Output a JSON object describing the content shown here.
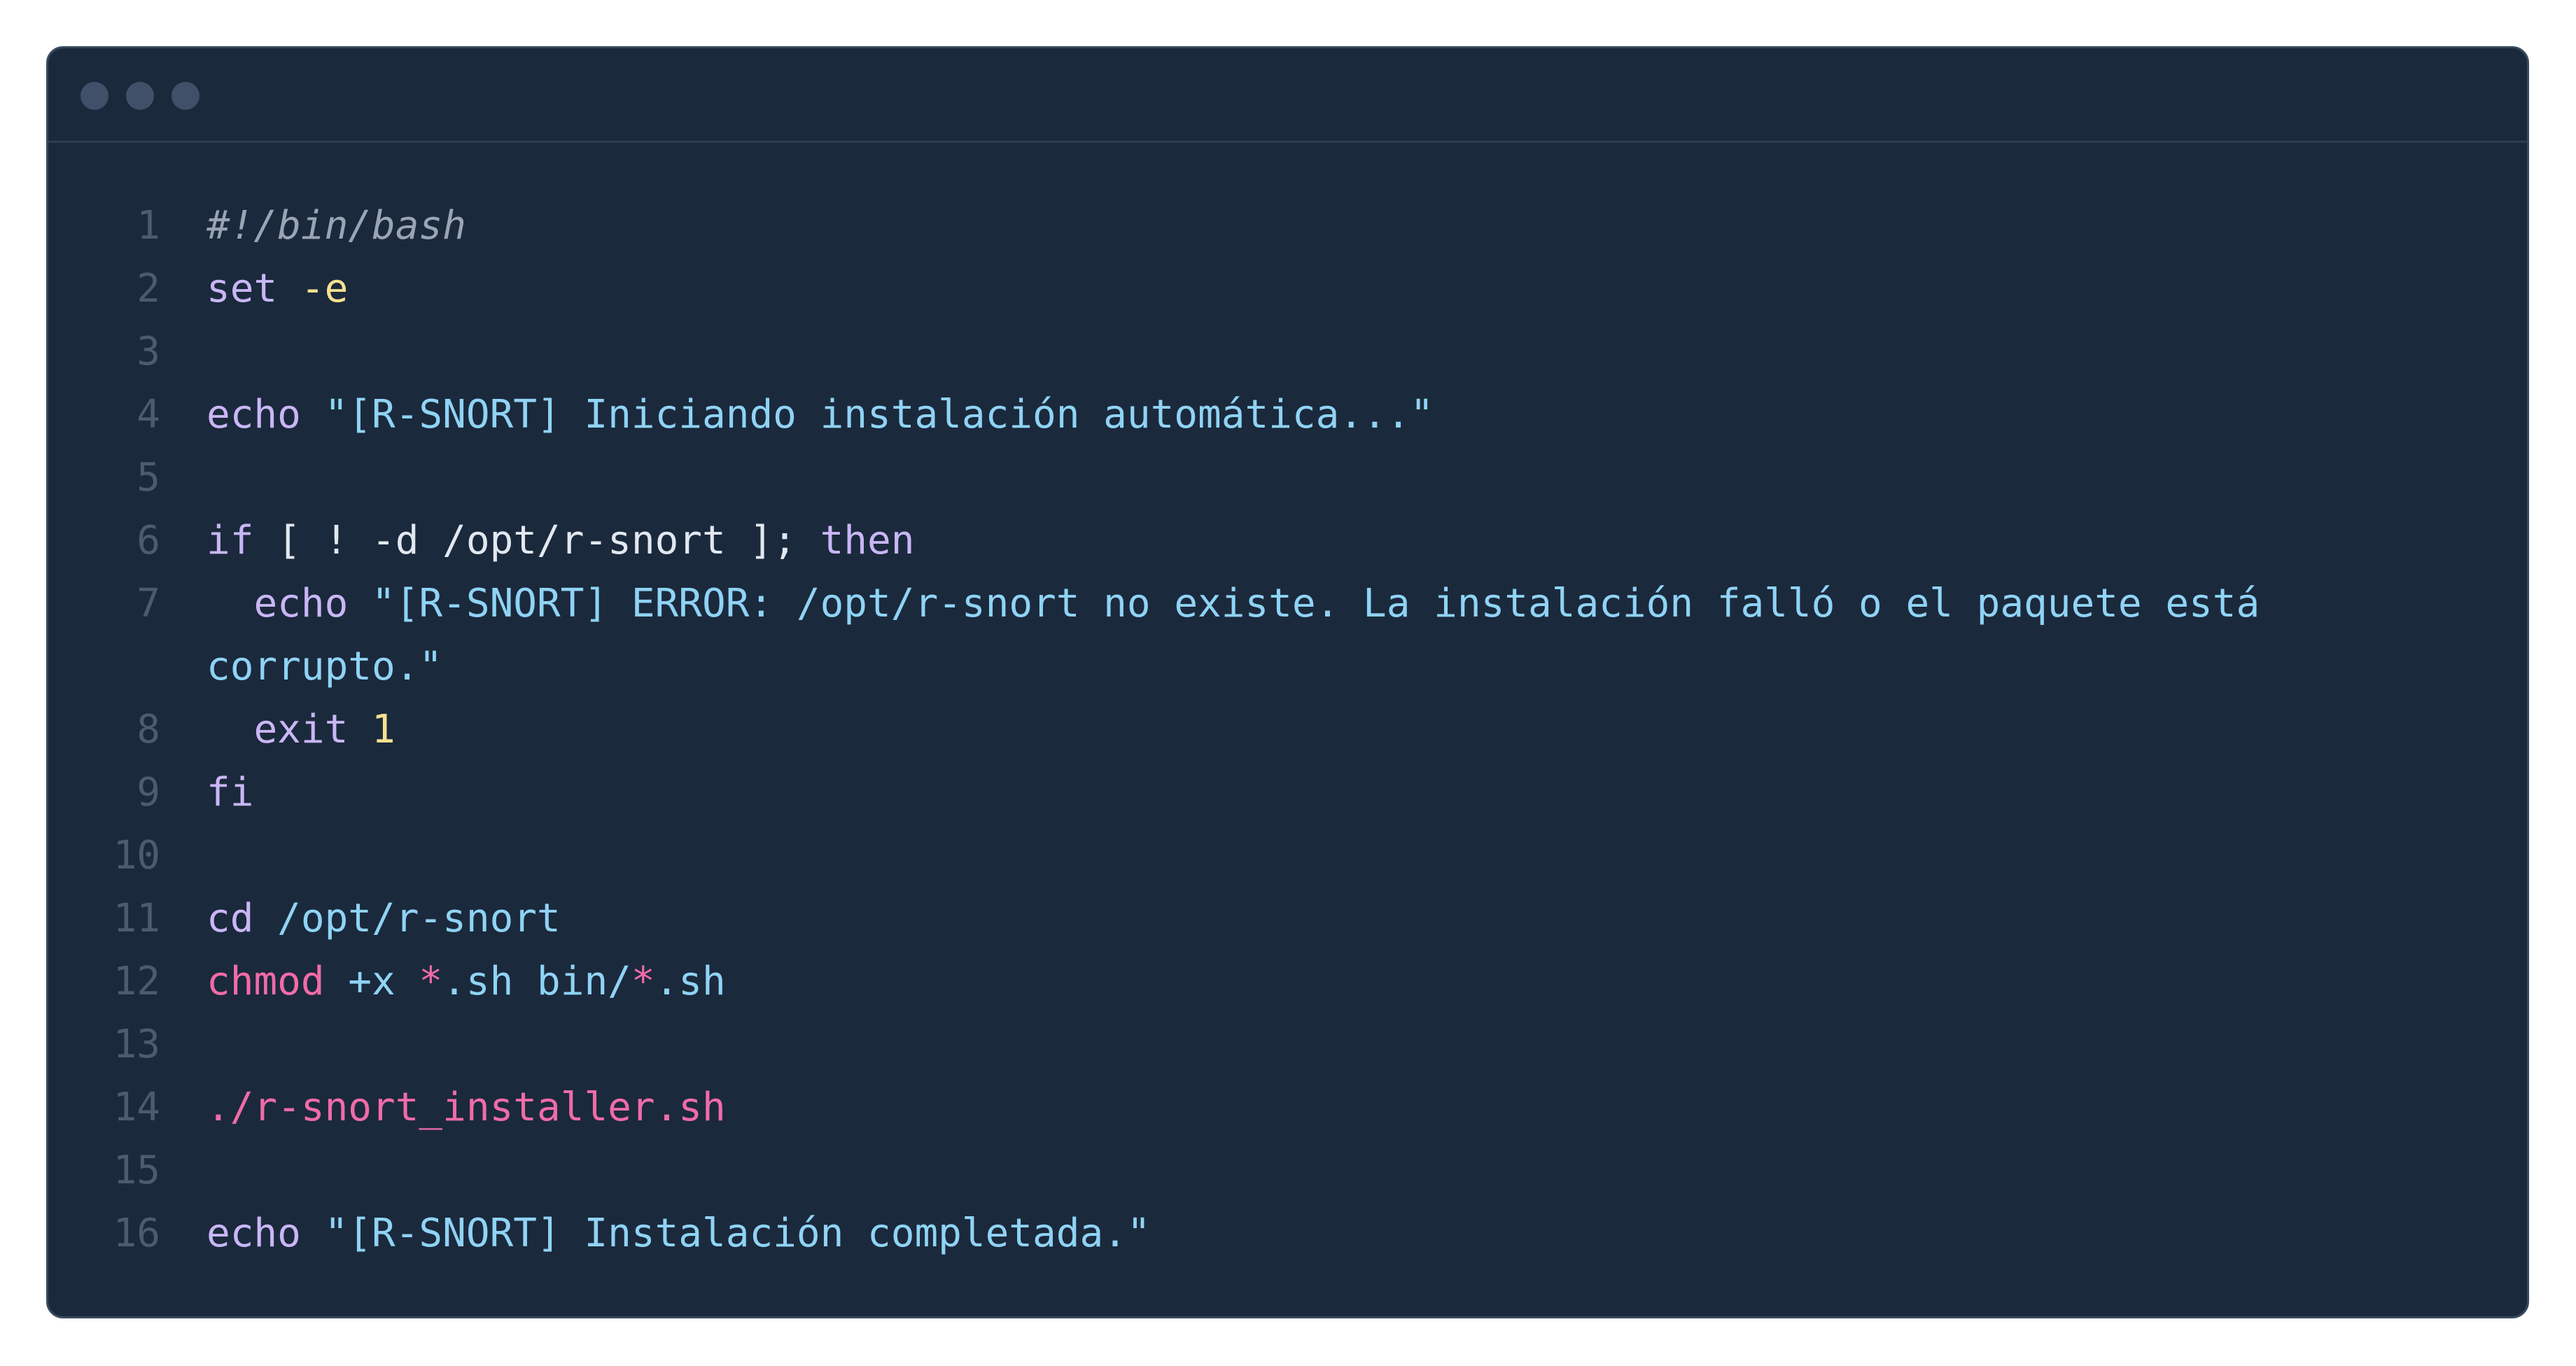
{
  "window": {
    "title_dots": [
      "close",
      "minimize",
      "maximize"
    ]
  },
  "code": {
    "lines": [
      {
        "n": "1",
        "t1": "#!/bin/bash"
      },
      {
        "n": "2",
        "t1": "set",
        "t2": " -e"
      },
      {
        "n": "3"
      },
      {
        "n": "4",
        "t1": "echo",
        "t2": " \"[R-SNORT] Iniciando instalación automática...\""
      },
      {
        "n": "5"
      },
      {
        "n": "6",
        "t1": "if",
        "t2": " [ ! -d /opt/r-snort ]; ",
        "t3": "then"
      },
      {
        "n": "7",
        "t1": "  echo",
        "t2": " \"[R-SNORT] ERROR: /opt/r-snort no existe. La instalación falló o el paquete está corrupto.\""
      },
      {
        "n": "8",
        "t1": "  exit",
        "t2": " 1"
      },
      {
        "n": "9",
        "t1": "fi"
      },
      {
        "n": "10"
      },
      {
        "n": "11",
        "t1": "cd",
        "t2": " /opt/r-snort"
      },
      {
        "n": "12",
        "t1": "chmod",
        "t2": " +x ",
        "t3": "*",
        "t4": ".sh bin/",
        "t5": "*",
        "t6": ".sh"
      },
      {
        "n": "13"
      },
      {
        "n": "14",
        "t1": "./r-snort_installer.sh"
      },
      {
        "n": "15"
      },
      {
        "n": "16",
        "t1": "echo",
        "t2": " \"[R-SNORT] Instalación completada.\""
      }
    ]
  },
  "colors": {
    "background": "#1b293c",
    "keyword": "#c9b6f5",
    "string": "#8fd3f5",
    "number": "#f5e18f",
    "command": "#f06ba8",
    "comment": "#9aa5b4",
    "line_number": "#4b5b70"
  }
}
